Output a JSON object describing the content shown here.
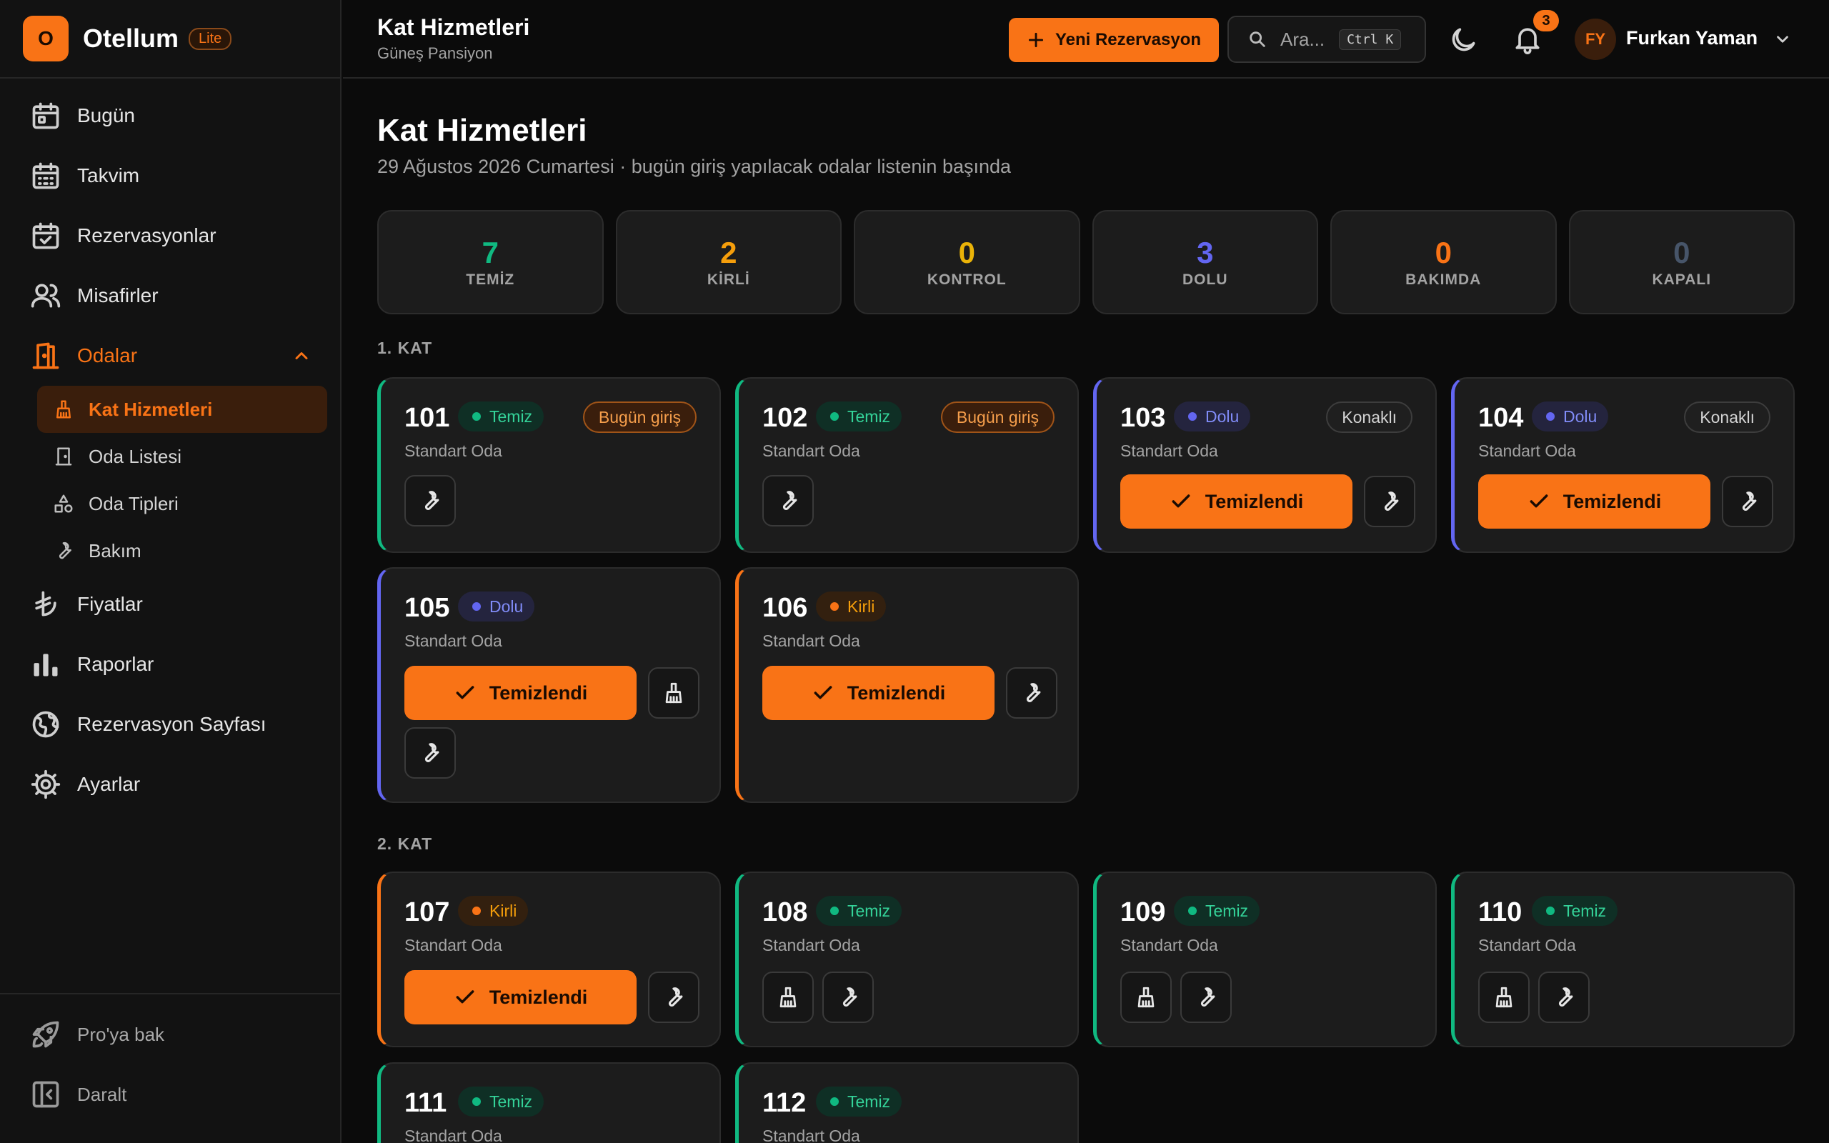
{
  "brand": {
    "initial": "O",
    "name": "Otellum",
    "badge": "Lite"
  },
  "sidebar": {
    "nav": [
      {
        "label": "Bugün",
        "icon": "calendar-day-icon"
      },
      {
        "label": "Takvim",
        "icon": "calendar-grid-icon"
      },
      {
        "label": "Rezervasyonlar",
        "icon": "calendar-check-icon"
      },
      {
        "label": "Misafirler",
        "icon": "users-icon"
      },
      {
        "label": "Odalar",
        "icon": "door-icon",
        "active": true
      },
      {
        "label": "Fiyatlar",
        "icon": "lira-icon"
      },
      {
        "label": "Raporlar",
        "icon": "bar-chart-icon"
      },
      {
        "label": "Rezervasyon Sayfası",
        "icon": "globe-icon"
      },
      {
        "label": "Ayarlar",
        "icon": "gear-icon"
      }
    ],
    "sub": [
      {
        "label": "Kat Hizmetleri",
        "icon": "broom-icon",
        "active": true
      },
      {
        "label": "Oda Listesi",
        "icon": "door-small-icon"
      },
      {
        "label": "Oda Tipleri",
        "icon": "shapes-icon"
      },
      {
        "label": "Bakım",
        "icon": "wrench-icon"
      }
    ],
    "bottom": [
      {
        "label": "Pro'ya bak",
        "icon": "rocket-icon"
      },
      {
        "label": "Daralt",
        "icon": "collapse-icon"
      }
    ]
  },
  "header": {
    "title": "Kat Hizmetleri",
    "subtitle": "Güneş Pansiyon",
    "new_button": "Yeni Rezervasyon",
    "search_placeholder": "Ara...",
    "search_shortcut": "Ctrl K",
    "notifications": "3",
    "user_initials": "FY",
    "user_name": "Furkan Yaman"
  },
  "page": {
    "title": "Kat Hizmetleri",
    "subtitle": "29 Ağustos 2026 Cumartesi · bugün giriş yapılacak odalar listenin başında"
  },
  "stats": [
    {
      "value": "7",
      "label": "TEMİZ",
      "color": "#10b981"
    },
    {
      "value": "2",
      "label": "KİRLİ",
      "color": "#f59e0b"
    },
    {
      "value": "0",
      "label": "KONTROL",
      "color": "#eab308"
    },
    {
      "value": "3",
      "label": "DOLU",
      "color": "#6366f1"
    },
    {
      "value": "0",
      "label": "BAKIMDA",
      "color": "#f97316"
    },
    {
      "value": "0",
      "label": "KAPALI",
      "color": "#475569"
    }
  ],
  "floors": [
    {
      "label": "1. KAT"
    },
    {
      "label": "2. KAT"
    }
  ],
  "rooms": [
    {
      "no": "101",
      "status": "Temiz",
      "type": "Standart Oda",
      "tag": "Bugün giriş"
    },
    {
      "no": "102",
      "status": "Temiz",
      "type": "Standart Oda",
      "tag": "Bugün giriş"
    },
    {
      "no": "103",
      "status": "Dolu",
      "type": "Standart Oda",
      "tag": "Konaklı"
    },
    {
      "no": "104",
      "status": "Dolu",
      "type": "Standart Oda",
      "tag": "Konaklı"
    },
    {
      "no": "105",
      "status": "Dolu",
      "type": "Standart Oda"
    },
    {
      "no": "106",
      "status": "Kirli",
      "type": "Standart Oda"
    },
    {
      "no": "107",
      "status": "Kirli",
      "type": "Standart Oda"
    },
    {
      "no": "108",
      "status": "Temiz",
      "type": "Standart Oda"
    },
    {
      "no": "109",
      "status": "Temiz",
      "type": "Standart Oda"
    },
    {
      "no": "110",
      "status": "Temiz",
      "type": "Standart Oda"
    },
    {
      "no": "111",
      "status": "Temiz",
      "type": "Standart Oda"
    },
    {
      "no": "112",
      "status": "Temiz",
      "type": "Standart Oda"
    }
  ],
  "actions": {
    "clean_button": "Temizlendi"
  }
}
